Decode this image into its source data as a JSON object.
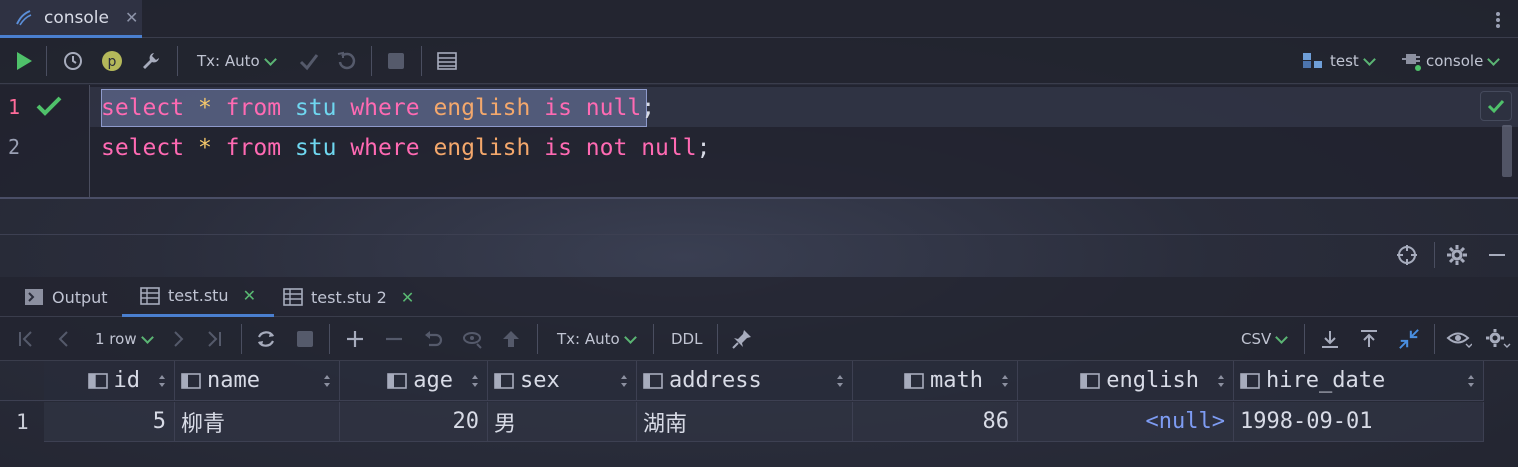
{
  "tab": {
    "title": "console",
    "close": "✕"
  },
  "toolbar": {
    "tx_label": "Tx: Auto",
    "datasource": "test",
    "session": "console"
  },
  "editor": {
    "line_numbers": [
      "1",
      "2"
    ],
    "lines": [
      [
        {
          "t": "select",
          "c": "kw"
        },
        {
          "t": " ",
          "c": "punc"
        },
        {
          "t": "*",
          "c": "star"
        },
        {
          "t": " ",
          "c": "punc"
        },
        {
          "t": "from",
          "c": "kw"
        },
        {
          "t": " ",
          "c": "punc"
        },
        {
          "t": "stu",
          "c": "tb"
        },
        {
          "t": " ",
          "c": "punc"
        },
        {
          "t": "where",
          "c": "kw"
        },
        {
          "t": " ",
          "c": "punc"
        },
        {
          "t": "english",
          "c": "col"
        },
        {
          "t": " ",
          "c": "punc"
        },
        {
          "t": "is",
          "c": "kw"
        },
        {
          "t": " ",
          "c": "punc"
        },
        {
          "t": "null",
          "c": "kw"
        },
        {
          "t": ";",
          "c": "punc"
        }
      ],
      [
        {
          "t": "select",
          "c": "kw"
        },
        {
          "t": " ",
          "c": "punc"
        },
        {
          "t": "*",
          "c": "star"
        },
        {
          "t": " ",
          "c": "punc"
        },
        {
          "t": "from",
          "c": "kw"
        },
        {
          "t": " ",
          "c": "punc"
        },
        {
          "t": "stu",
          "c": "tb"
        },
        {
          "t": " ",
          "c": "punc"
        },
        {
          "t": "where",
          "c": "kw"
        },
        {
          "t": " ",
          "c": "punc"
        },
        {
          "t": "english",
          "c": "col"
        },
        {
          "t": " ",
          "c": "punc"
        },
        {
          "t": "is",
          "c": "kw"
        },
        {
          "t": " ",
          "c": "punc"
        },
        {
          "t": "not",
          "c": "kw"
        },
        {
          "t": " ",
          "c": "punc"
        },
        {
          "t": "null",
          "c": "kw"
        },
        {
          "t": ";",
          "c": "punc"
        }
      ]
    ]
  },
  "results": {
    "tabs": [
      {
        "label": "Output"
      },
      {
        "label": "test.stu",
        "close": "✕"
      },
      {
        "label": "test.stu 2",
        "close": "✕"
      }
    ],
    "toolbar": {
      "row_count": "1 row",
      "tx_label": "Tx: Auto",
      "ddl": "DDL",
      "export_format": "CSV"
    },
    "columns": [
      "id",
      "name",
      "age",
      "sex",
      "address",
      "math",
      "english",
      "hire_date"
    ],
    "rows": [
      {
        "num": "1",
        "cells": [
          "5",
          "柳青",
          "20",
          "男",
          "湖南",
          "86",
          "<null>",
          "1998-09-01"
        ]
      }
    ]
  },
  "colors": {
    "keyword": "#ff6ab3",
    "table": "#6fd7f0",
    "column": "#f4a86c",
    "accent_green": "#59b872",
    "accent_blue": "#4a7fcf",
    "null_value": "#7e9cf3"
  }
}
